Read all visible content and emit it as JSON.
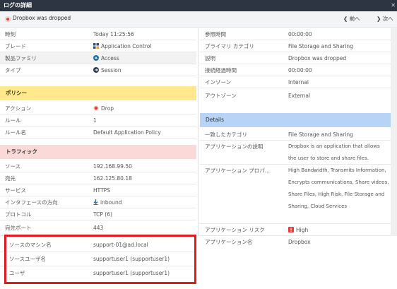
{
  "window": {
    "title": "ログの詳細"
  },
  "header": {
    "message": "Dropbox was dropped",
    "prev_label": "前へ",
    "next_label": "次へ"
  },
  "left": {
    "general": [
      {
        "label": "時刻",
        "value": "Today 11:25:56",
        "icon": ""
      },
      {
        "label": "ブレード",
        "value": "Application Control",
        "icon": "grid-icon"
      },
      {
        "label": "製品ファミリ",
        "value": "Access",
        "icon": "access-icon"
      },
      {
        "label": "タイプ",
        "value": "Session",
        "icon": "session-icon"
      }
    ],
    "policy_title": "ポリシー",
    "policy": [
      {
        "label": "アクション",
        "value": "Drop",
        "icon": "drop-icon"
      },
      {
        "label": "ルール",
        "value": "1",
        "icon": ""
      },
      {
        "label": "ルール名",
        "value": "Default Application Policy",
        "icon": ""
      }
    ],
    "traffic_title": "トラフィック",
    "traffic": [
      {
        "label": "ソース",
        "value": "192.168.99.50",
        "icon": ""
      },
      {
        "label": "宛先",
        "value": "162.125.80.18",
        "icon": ""
      },
      {
        "label": "サービス",
        "value": "HTTPS",
        "icon": ""
      },
      {
        "label": "インタフェースの方向",
        "value": "inbound",
        "icon": "inbound-icon"
      },
      {
        "label": "プロトコル",
        "value": "TCP (6)",
        "icon": ""
      },
      {
        "label": "宛先ポート",
        "value": "443",
        "icon": ""
      },
      {
        "label": "ソースのマシン名",
        "value": "support-01@ad.local",
        "icon": ""
      },
      {
        "label": "ソースユーザ名",
        "value": "supportuser1 (supportuser1)",
        "icon": ""
      },
      {
        "label": "ユーザ",
        "value": "supportuser1 (supportuser1)",
        "icon": ""
      }
    ]
  },
  "right": {
    "general": [
      {
        "label": "参照時間",
        "value": "00:00:00"
      },
      {
        "label": "プライマリ カテゴリ",
        "value": "File Storage and Sharing"
      },
      {
        "label": "説明",
        "value": "Dropbox was dropped"
      },
      {
        "label": "接続経過時間",
        "value": "00:00:00"
      },
      {
        "label": "インゾーン",
        "value": "Internal"
      },
      {
        "label": "アウトゾーン",
        "value": "External"
      }
    ],
    "details_title": "Details",
    "details": [
      {
        "label": "一致したカテゴリ",
        "value": "File Storage and Sharing"
      },
      {
        "label": "アプリケーションの説明",
        "value": "Dropbox is an application that allows the user to store and share files."
      },
      {
        "label": "アプリケーション プロパ...",
        "value": "High Bandwidth, Transmits Information, Encrypts communications, Share videos, Share Files, High Risk, File Storage and Sharing, Cloud Services"
      },
      {
        "label": "アプリケーション リスク",
        "value": "High"
      },
      {
        "label": "アプリケーション名",
        "value": "Dropbox"
      }
    ]
  },
  "colors": {
    "policy_header": "#ffe98c",
    "traffic_header": "#fbd9d9",
    "details_header": "#b7d3f6",
    "highlight": "#e21a1a"
  }
}
